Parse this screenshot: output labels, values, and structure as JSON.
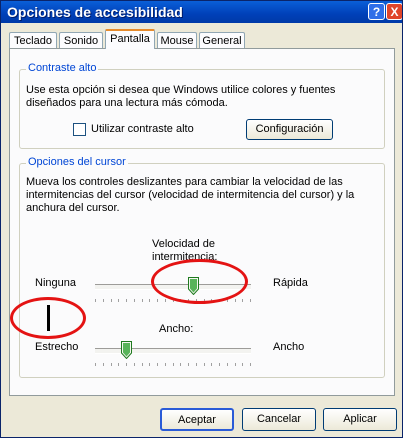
{
  "window": {
    "title": "Opciones de accesibilidad",
    "help_label": "?",
    "close_label": "X"
  },
  "tabs": [
    {
      "label": "Teclado"
    },
    {
      "label": "Sonido"
    },
    {
      "label": "Pantalla",
      "active": true
    },
    {
      "label": "Mouse"
    },
    {
      "label": "General"
    }
  ],
  "contrast": {
    "group_title": "Contraste alto",
    "description": "Use esta opción si desea que Windows utilice colores y fuentes diseñados para una lectura más cómoda.",
    "checkbox_label": "Utilizar contraste alto",
    "checked": false,
    "config_button": "Configuración"
  },
  "cursor": {
    "group_title": "Opciones del cursor",
    "description": "Mueva los controles deslizantes para cambiar la velocidad de las intermitencias del cursor (velocidad de intermitencia del cursor) y la anchura del cursor.",
    "blink": {
      "label": "Velocidad de intermitencia:",
      "min_label": "Ninguna",
      "max_label": "Rápida",
      "value_fraction": 0.63
    },
    "width": {
      "label": "Ancho:",
      "min_label": "Estrecho",
      "max_label": "Ancho",
      "value_fraction": 0.2
    }
  },
  "buttons": {
    "ok": "Aceptar",
    "cancel": "Cancelar",
    "apply": "Aplicar"
  },
  "annotation_color": "#e41313"
}
